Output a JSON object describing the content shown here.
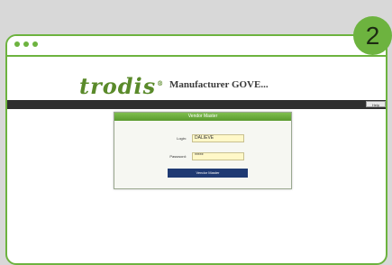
{
  "badge": {
    "step_number": "2"
  },
  "brand": {
    "logo_text": "trodis",
    "logo_mark": "®",
    "title": "Manufacturer GOVE..."
  },
  "nav": {
    "button_label": "Help"
  },
  "login_panel": {
    "header": "Vendor Master",
    "fields": [
      {
        "label": "Login:",
        "value": "DALIEVE"
      },
      {
        "label": "Password:",
        "value": "*****"
      }
    ],
    "submit_label": "Vendor Master"
  },
  "colors": {
    "accent_green": "#6db33f",
    "nav_bar": "#2f2f2f",
    "submit_button": "#1f3a73",
    "input_fill": "#fff8c8"
  },
  "icons": {
    "window_dots": [
      "dot-icon",
      "dot-icon",
      "dot-icon"
    ]
  }
}
